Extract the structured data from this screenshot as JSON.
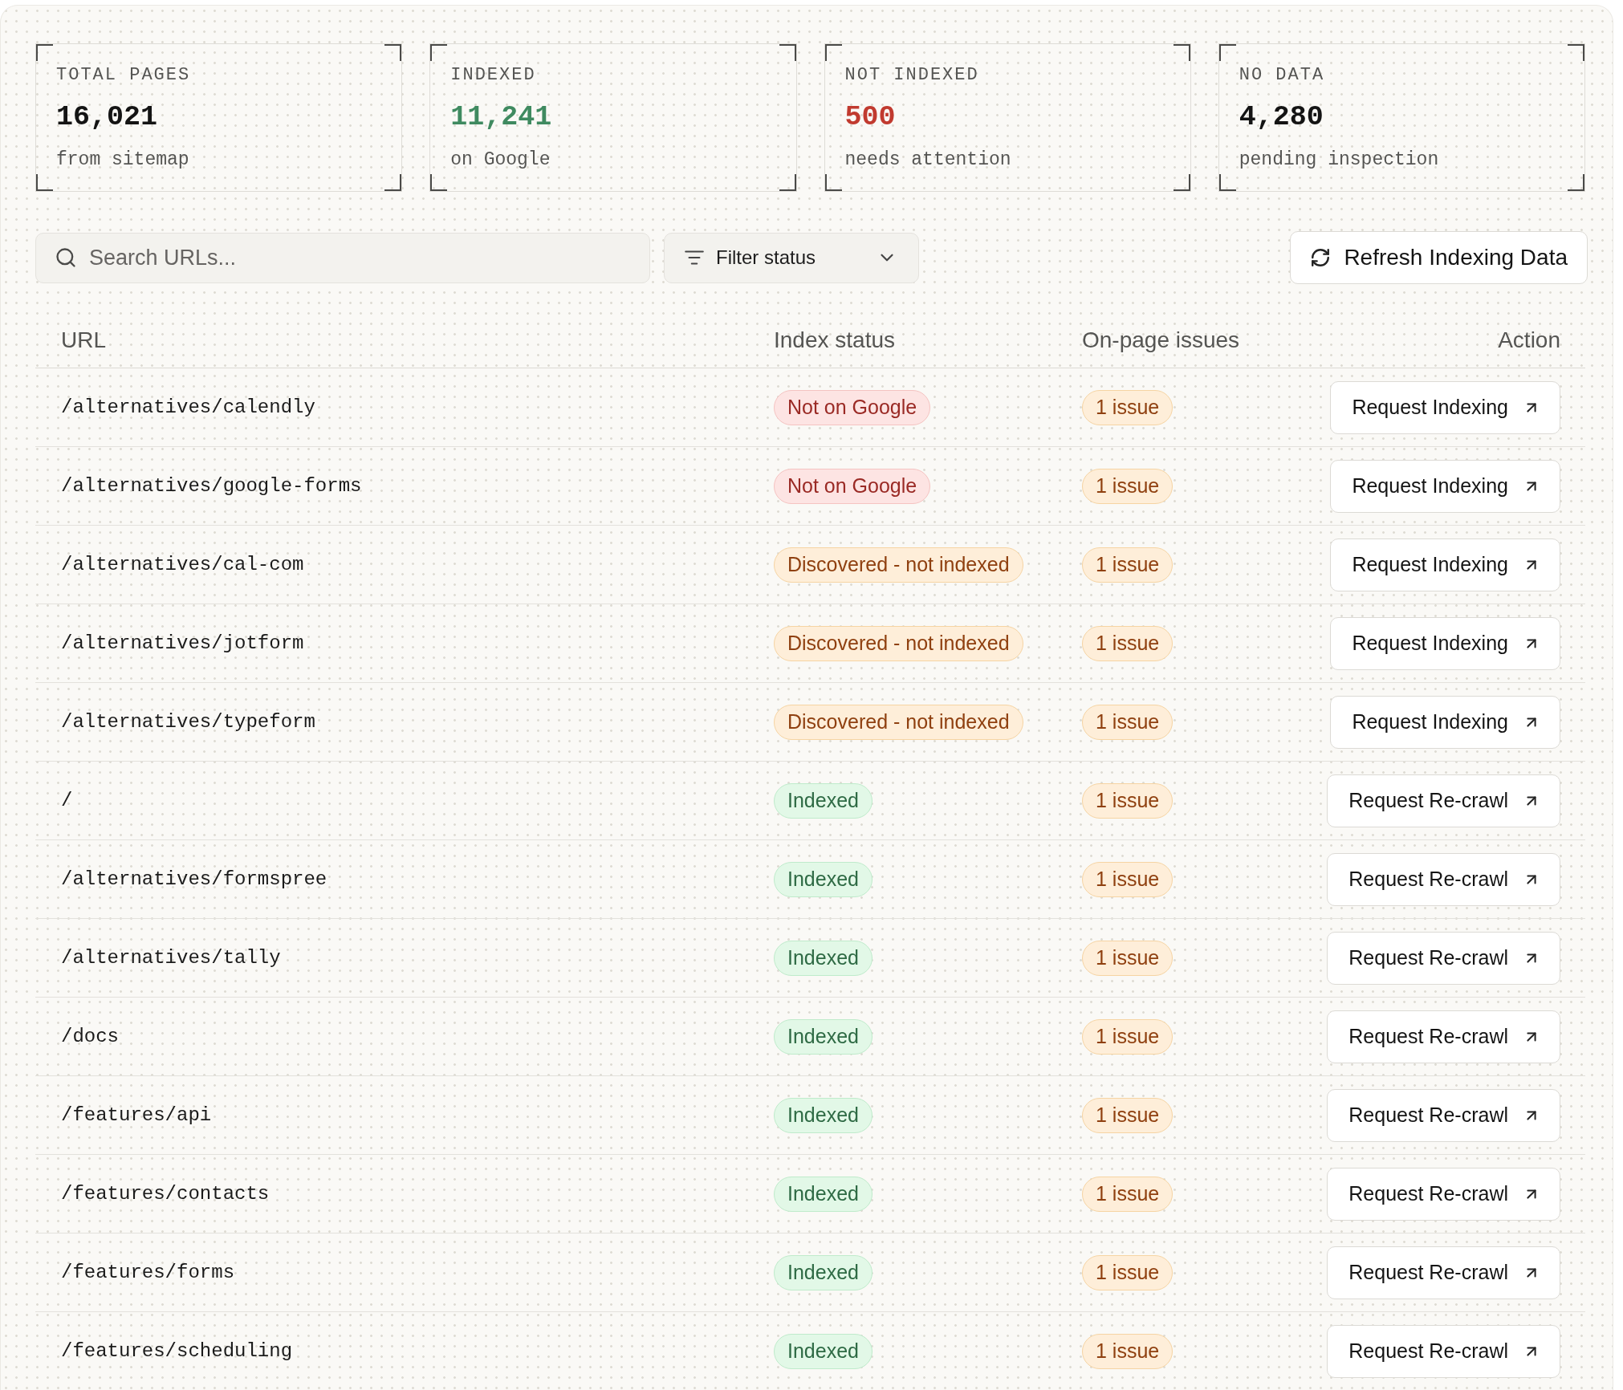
{
  "stats": [
    {
      "label": "TOTAL PAGES",
      "value": "16,021",
      "caption": "from sitemap",
      "color": "#141414"
    },
    {
      "label": "INDEXED",
      "value": "11,241",
      "caption": "on Google",
      "color": "#3f8a60"
    },
    {
      "label": "NOT INDEXED",
      "value": "500",
      "caption": "needs attention",
      "color": "#c13a2f"
    },
    {
      "label": "NO DATA",
      "value": "4,280",
      "caption": "pending inspection",
      "color": "#141414"
    }
  ],
  "toolbar": {
    "search": {
      "placeholder": "Search URLs..."
    },
    "filter": {
      "label": "Filter status"
    },
    "refresh": {
      "label": "Refresh Indexing Data"
    }
  },
  "table": {
    "columns": [
      "URL",
      "Index status",
      "On-page issues",
      "Action"
    ],
    "rows": [
      {
        "url": "/alternatives/calendly",
        "status": {
          "label": "Not on Google",
          "kind": "error"
        },
        "issues": "1 issue",
        "action": "Request Indexing"
      },
      {
        "url": "/alternatives/google-forms",
        "status": {
          "label": "Not on Google",
          "kind": "error"
        },
        "issues": "1 issue",
        "action": "Request Indexing"
      },
      {
        "url": "/alternatives/cal-com",
        "status": {
          "label": "Discovered - not indexed",
          "kind": "warning"
        },
        "issues": "1 issue",
        "action": "Request Indexing"
      },
      {
        "url": "/alternatives/jotform",
        "status": {
          "label": "Discovered - not indexed",
          "kind": "warning"
        },
        "issues": "1 issue",
        "action": "Request Indexing"
      },
      {
        "url": "/alternatives/typeform",
        "status": {
          "label": "Discovered - not indexed",
          "kind": "warning"
        },
        "issues": "1 issue",
        "action": "Request Indexing"
      },
      {
        "url": "/",
        "status": {
          "label": "Indexed",
          "kind": "success"
        },
        "issues": "1 issue",
        "action": "Request Re-crawl"
      },
      {
        "url": "/alternatives/formspree",
        "status": {
          "label": "Indexed",
          "kind": "success"
        },
        "issues": "1 issue",
        "action": "Request Re-crawl"
      },
      {
        "url": "/alternatives/tally",
        "status": {
          "label": "Indexed",
          "kind": "success"
        },
        "issues": "1 issue",
        "action": "Request Re-crawl"
      },
      {
        "url": "/docs",
        "status": {
          "label": "Indexed",
          "kind": "success"
        },
        "issues": "1 issue",
        "action": "Request Re-crawl"
      },
      {
        "url": "/features/api",
        "status": {
          "label": "Indexed",
          "kind": "success"
        },
        "issues": "1 issue",
        "action": "Request Re-crawl"
      },
      {
        "url": "/features/contacts",
        "status": {
          "label": "Indexed",
          "kind": "success"
        },
        "issues": "1 issue",
        "action": "Request Re-crawl"
      },
      {
        "url": "/features/forms",
        "status": {
          "label": "Indexed",
          "kind": "success"
        },
        "issues": "1 issue",
        "action": "Request Re-crawl"
      },
      {
        "url": "/features/scheduling",
        "status": {
          "label": "Indexed",
          "kind": "success"
        },
        "issues": "1 issue",
        "action": "Request Re-crawl"
      }
    ]
  }
}
